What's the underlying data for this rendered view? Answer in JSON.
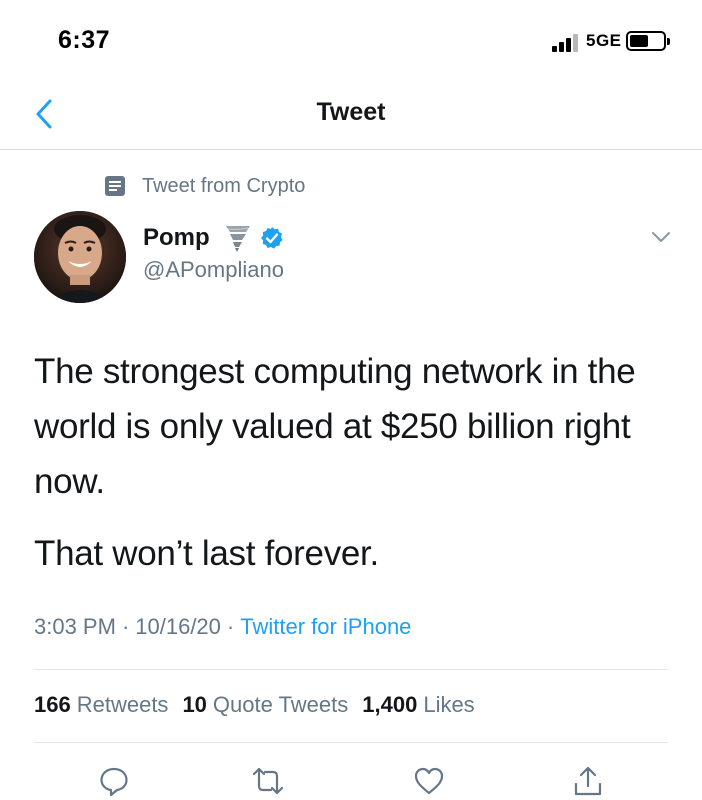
{
  "status_bar": {
    "time": "6:37",
    "network": "5GE"
  },
  "nav": {
    "title": "Tweet",
    "back_icon": "chevron-left-icon"
  },
  "tweet": {
    "context_label": "Tweet from Crypto",
    "author": {
      "display_name": "Pomp",
      "handle": "@APompliano",
      "emoji_icon": "tornado-icon",
      "verified": true
    },
    "text_lines": [
      "The strongest computing network in the world is only valued at $250 billion right now.",
      "That won’t last forever."
    ],
    "time": "3:03 PM",
    "date": "10/16/20",
    "separator": "·",
    "source": "Twitter for iPhone",
    "stats": {
      "retweets_count": "166",
      "retweets_label": "Retweets",
      "quotes_count": "10",
      "quotes_label": "Quote Tweets",
      "likes_count": "1,400",
      "likes_label": "Likes"
    }
  },
  "actions": [
    "reply-icon",
    "retweet-icon",
    "like-icon",
    "share-icon"
  ],
  "colors": {
    "accent": "#1da1f2",
    "text_primary": "#14171a",
    "text_secondary": "#657786",
    "divider": "#e1e8ed"
  }
}
